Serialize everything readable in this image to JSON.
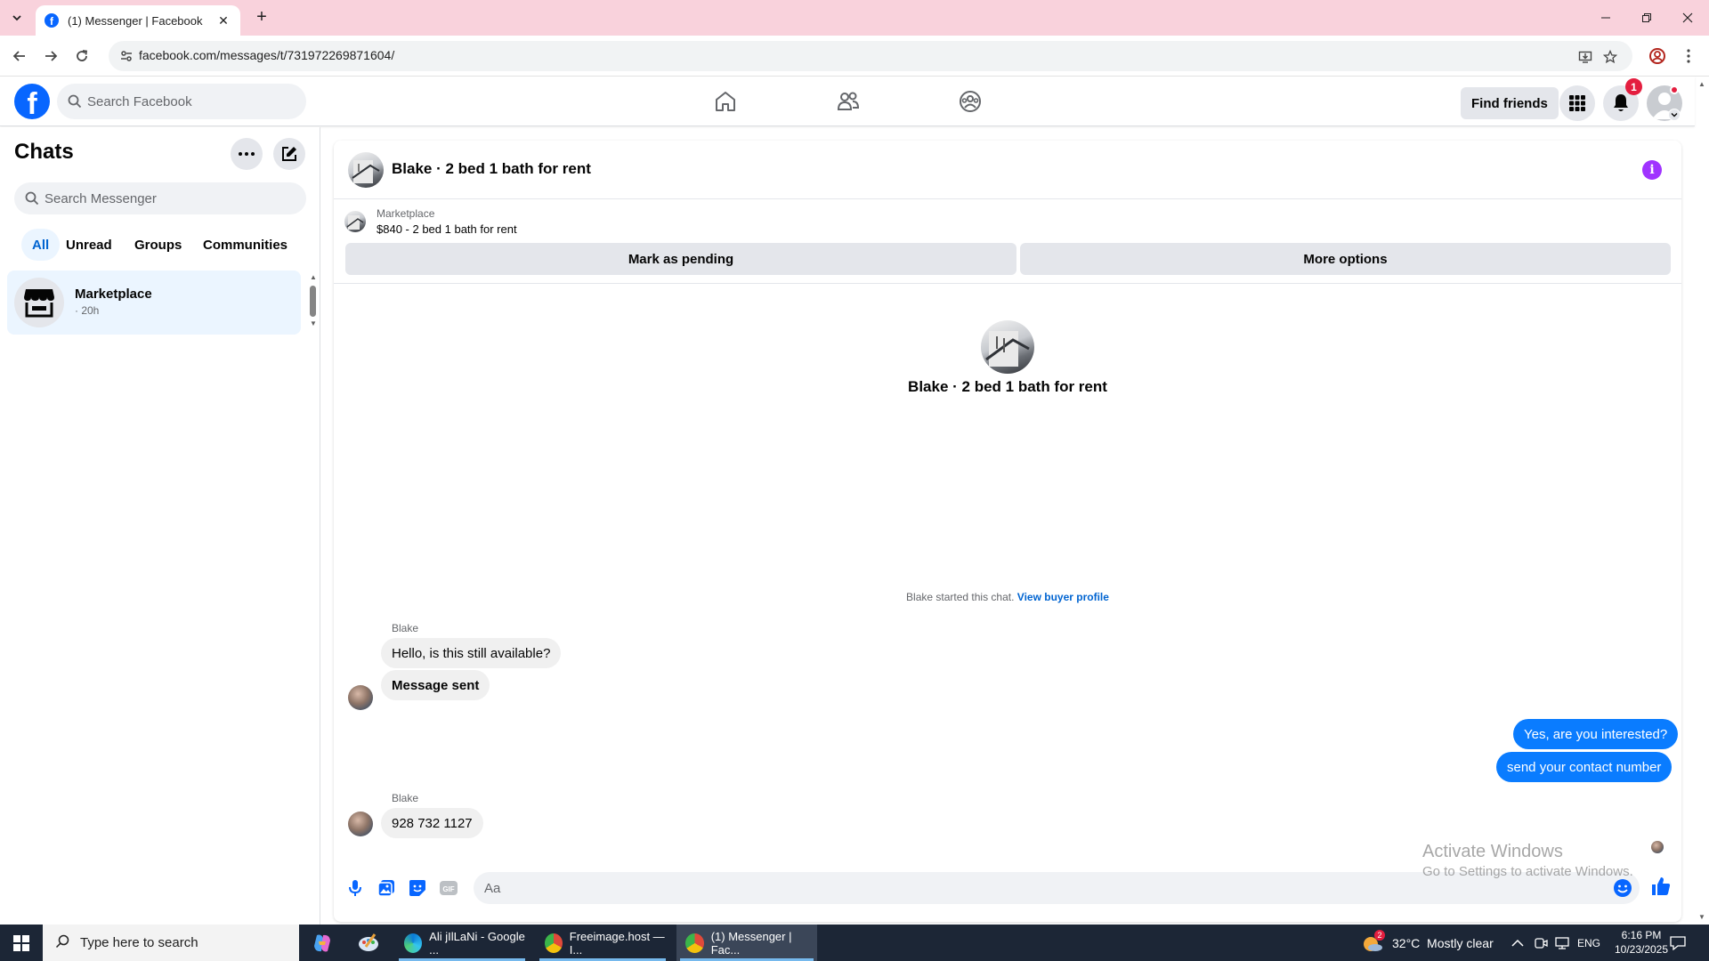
{
  "browser": {
    "tab_title": "(1) Messenger | Facebook",
    "url": "facebook.com/messages/t/731972269871604/",
    "new_tab_symbol": "+",
    "tab_close_symbol": "✕"
  },
  "fb_nav": {
    "search_placeholder": "Search Facebook",
    "find_friends_label": "Find friends",
    "notification_count": "1"
  },
  "chats_panel": {
    "title": "Chats",
    "search_placeholder": "Search Messenger",
    "filters": [
      "All",
      "Unread",
      "Groups",
      "Communities"
    ],
    "active_filter": "All",
    "conversations": [
      {
        "name": "Marketplace",
        "time": "· 20h"
      }
    ]
  },
  "conversation": {
    "title": "Blake · 2 bed 1 bath for rent",
    "listing": {
      "category": "Marketplace",
      "title": "$840 - 2 bed 1 bath for rent",
      "mark_pending_label": "Mark as pending",
      "more_options_label": "More options"
    },
    "center_name": "Blake · 2 bed 1 bath for rent",
    "started_text": "Blake started this chat.",
    "view_buyer_profile": "View buyer profile",
    "messages": [
      {
        "sender": "Blake",
        "text": "Hello, is this still available?",
        "direction": "in"
      },
      {
        "sender": "",
        "text": "Message sent",
        "direction": "in"
      },
      {
        "sender": "",
        "text": "Yes, are you interested?",
        "direction": "out"
      },
      {
        "sender": "",
        "text": "send your contact number",
        "direction": "out"
      },
      {
        "sender": "Blake",
        "text": "928 732 1127",
        "direction": "in"
      }
    ],
    "composer_placeholder": "Aa"
  },
  "watermark": {
    "line1": "Activate Windows",
    "line2": "Go to Settings to activate Windows."
  },
  "taskbar": {
    "search_placeholder": "Type here to search",
    "tasks": [
      {
        "label": "Ali jIlLaNi - Google ...",
        "color": "#0b7bd6"
      },
      {
        "label": "Freeimage.host — I...",
        "color": "#e04a3a"
      },
      {
        "label": "(1) Messenger | Fac...",
        "color": "#e04a3a"
      }
    ],
    "weather_badge": "2",
    "weather": "32°C  Mostly clear",
    "language": "ENG",
    "time": "6:16 PM",
    "date": "10/23/2025"
  },
  "colors": {
    "tabstrip": "#f9d2dc",
    "fb_blue": "#0866ff",
    "bubble_out": "#0a7cff",
    "bubble_in": "#f0f0f0",
    "info_purple": "#a033ff",
    "taskbar": "#1c2636"
  }
}
